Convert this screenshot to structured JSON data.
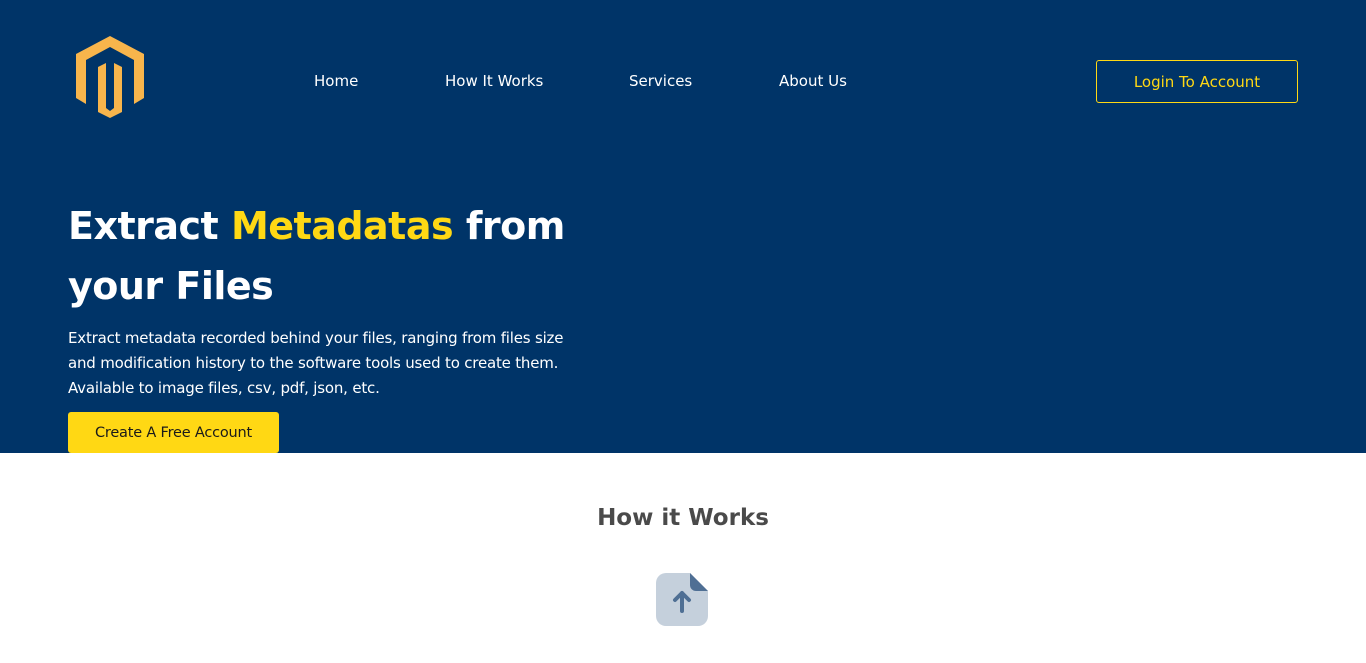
{
  "header": {
    "logo_icon": "magento-style-logo-icon",
    "nav": [
      {
        "label": "Home"
      },
      {
        "label": "How It Works"
      },
      {
        "label": "Services"
      },
      {
        "label": "About Us"
      }
    ],
    "login_label": "Login To Account"
  },
  "hero": {
    "headline_pre": "Extract ",
    "headline_accent": "Metadatas",
    "headline_post": " from your Files",
    "subtitle": "Extract metadata recorded behind your files, ranging from files size and modification history to the software tools used to create them. Available to image files, csv, pdf, json, etc.",
    "cta_label": "Create A Free Account"
  },
  "how_it_works": {
    "title": "How it Works",
    "icon": "file-upload-icon"
  },
  "colors": {
    "hero_bg": "#003468",
    "accent": "#ffd814",
    "logo": "#f8b54c",
    "section_title": "#4a4a4a"
  }
}
